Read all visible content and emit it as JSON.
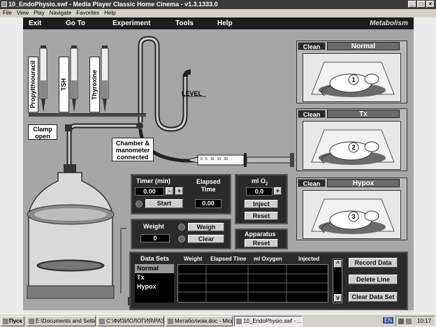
{
  "window": {
    "title": "10_EndoPhysio.swf - Media Player Classic Home Cinema - v1.3.1333.0"
  },
  "menubar": [
    "File",
    "View",
    "Play",
    "Navigate",
    "Favorites",
    "Help"
  ],
  "nav": {
    "exit": "Exit",
    "goto": "Go To",
    "experiment": "Experiment",
    "tools": "Tools",
    "help": "Help",
    "brand": "Metabolism"
  },
  "drugs": [
    "Propylthiouracil",
    "TSH",
    "Thyroxine"
  ],
  "labels": {
    "clamp": [
      "Clamp",
      "open"
    ],
    "chamber": [
      "Chamber &",
      "manometer",
      "connected"
    ],
    "level": "LEVEL",
    "syringe_scale": "0   5   10   15   20"
  },
  "cages": [
    {
      "clean": "Clean",
      "name": "Normal",
      "num": "1"
    },
    {
      "clean": "Clean",
      "name": "Tx",
      "num": "2"
    },
    {
      "clean": "Clean",
      "name": "Hypox",
      "num": "3"
    }
  ],
  "timer": {
    "title": "Timer (min)",
    "value": "0.00",
    "minus": "-",
    "plus": "+",
    "elapsed_title": [
      "Elapsed",
      "Time"
    ],
    "elapsed_value": "0.00",
    "start": "Start"
  },
  "oxygen": {
    "title": "ml O",
    "sub": "2",
    "value": "0.0",
    "plus": "+",
    "inject": "Inject",
    "reset": "Reset"
  },
  "weight": {
    "title": "Weight",
    "value": "0",
    "weigh": "Weigh",
    "clear": "Clear"
  },
  "apparatus": {
    "title": "Apparatus",
    "reset": "Reset"
  },
  "datasets": {
    "title": "Data Sets",
    "items": [
      "Normal",
      "Tx",
      "Hypox"
    ],
    "columns": [
      "Weight",
      "Elapsed Time",
      "ml Oxygen",
      "Injected"
    ],
    "up": "^",
    "down": "v"
  },
  "actions": {
    "record": "Record Data",
    "delete": "Delete Line",
    "clear_all": "Clear Data Set"
  },
  "taskbar": {
    "start": "Пуск",
    "items": [
      "E:\\Documents and Settin...",
      "C:\\ФИЗИОЛОГИЯ\\РАЗН...",
      "Метаболизм.doc - Micro...",
      "10_EndoPhysio.swf - ..."
    ],
    "lang": "EN",
    "clock": "10:17"
  }
}
